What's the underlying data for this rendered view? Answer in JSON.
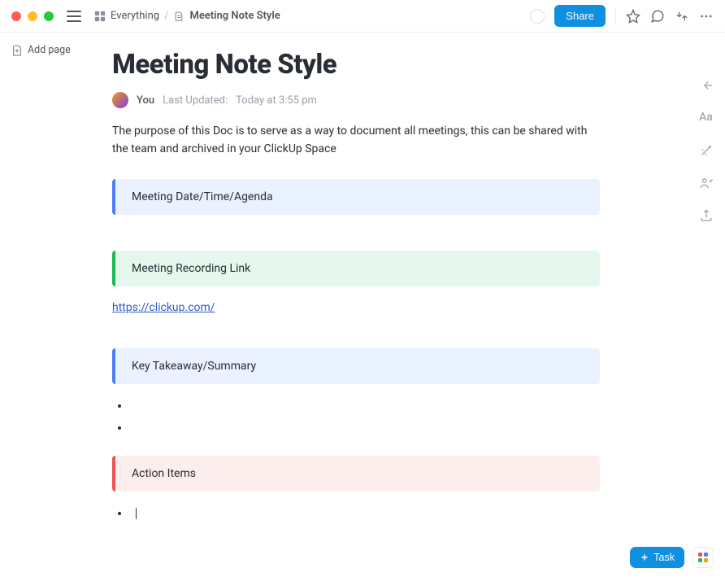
{
  "topbar": {
    "breadcrumb_root": "Everything",
    "breadcrumb_current": "Meeting Note Style",
    "share_label": "Share"
  },
  "sidebar": {
    "add_page_label": "Add page"
  },
  "doc": {
    "title": "Meeting Note Style",
    "author": "You",
    "updated_label": "Last Updated:",
    "updated_value": "Today at 3:55 pm",
    "intro": "The purpose of this Doc is to serve as a way to document all meetings, this can be shared with the team and archived in your ClickUp Space",
    "section_meeting_datetime": "Meeting Date/Time/Agenda",
    "section_recording": "Meeting Recording Link",
    "recording_url": "https://clickup.com/",
    "section_takeaway": "Key Takeaway/Summary",
    "section_actions": "Action Items"
  },
  "bottom": {
    "task_label": "Task"
  }
}
